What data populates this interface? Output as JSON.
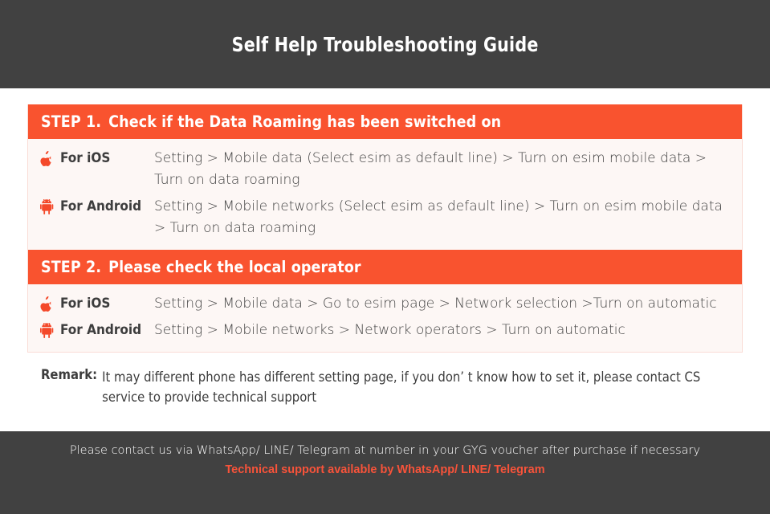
{
  "header": {
    "title": "Self Help Troubleshooting Guide",
    "background_color": "#414141",
    "text_color": "#FFFFFF"
  },
  "theme": {
    "accent_color": "#F9532F",
    "panel_background": "#FDF7F5",
    "panel_border": "#FADCD6",
    "body_text_color": "#3F3F3F",
    "footer_accent": "#F8533A"
  },
  "steps": [
    {
      "number": "STEP 1.",
      "title": "Check if the Data Roaming has been switched on",
      "rows": [
        {
          "icon": "apple-logo-icon",
          "os_label": "For iOS",
          "instructions": "Setting > Mobile data (Select esim as default line) > Turn on esim mobile data > Turn on data roaming"
        },
        {
          "icon": "android-robot-icon",
          "os_label": "For Android",
          "instructions": "Setting > Mobile networks (Select esim as default line) > Turn on esim mobile data > Turn on data roaming"
        }
      ]
    },
    {
      "number": "STEP 2.",
      "title": "Please check the local operator",
      "rows": [
        {
          "icon": "apple-logo-icon",
          "os_label": "For iOS",
          "instructions": "Setting > Mobile data > Go to esim page > Network selection >Turn on automatic"
        },
        {
          "icon": "android-robot-icon",
          "os_label": "For Android",
          "instructions": "Setting > Mobile networks > Network operators > Turn on automatic"
        }
      ]
    }
  ],
  "remark": {
    "label": "Remark:",
    "text": "It may different phone has different setting page, if you don’ t know how to set it,  please contact CS service to provide technical support"
  },
  "footer": {
    "line1": "Please contact us via WhatsApp/ LINE/ Telegram at number in your GYG voucher after purchase if necessary",
    "line2": "Technical support available by WhatsApp/ LINE/ Telegram"
  }
}
